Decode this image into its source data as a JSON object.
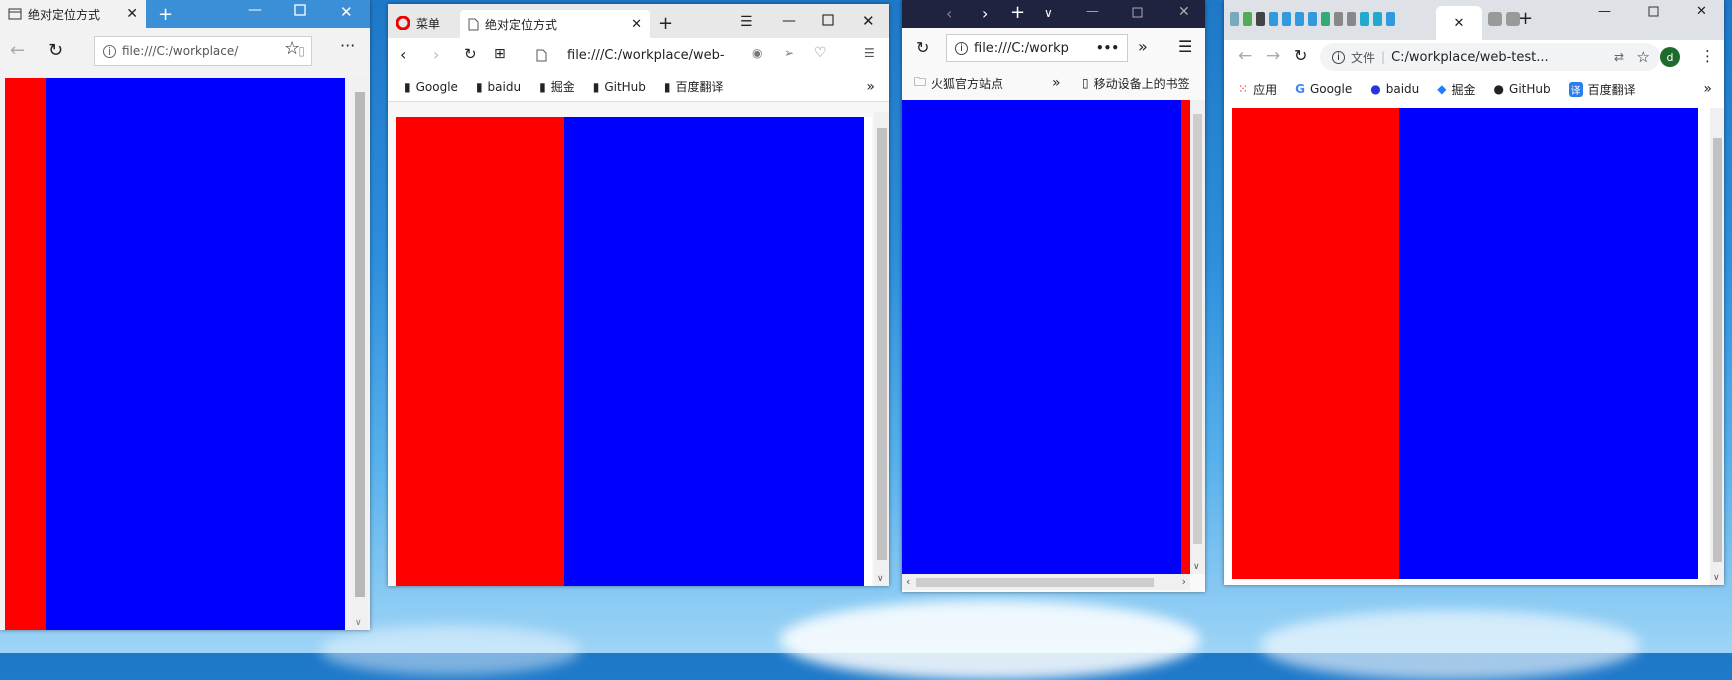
{
  "colors": {
    "red_box": "#ff0000",
    "blue_box": "#0000ff",
    "scroll_thumb": "#c2c2c2"
  },
  "edge": {
    "tab_title": "绝对定位方式",
    "url": "file:///C:/workplace/",
    "icons": [
      "page-icon",
      "close-icon",
      "new-tab-icon",
      "minimize-icon",
      "maximize-icon",
      "close-window-icon",
      "back-icon",
      "refresh-icon",
      "info-icon",
      "reading-view-icon",
      "favorite-star-icon",
      "more-icon"
    ]
  },
  "opera": {
    "menu_label": "菜单",
    "tab_title": "绝对定位方式",
    "url": "file:///C:/workplace/web-",
    "bookmarks": [
      "Google",
      "baidu",
      "掘金",
      "GitHub",
      "百度翻译"
    ],
    "more": "»"
  },
  "firefox": {
    "url": "file:///C:/workp",
    "bookmarks": [
      "火狐官方站点"
    ],
    "mobile_bookmarks": "移动设备上的书签",
    "more": "»"
  },
  "chrome": {
    "file_label": "文件",
    "url": "C:/workplace/web-test...",
    "profile_letter": "d",
    "bookmarks": [
      "应用",
      "Google",
      "baidu",
      "掘金",
      "GitHub",
      "百度翻译"
    ],
    "more": "»"
  }
}
